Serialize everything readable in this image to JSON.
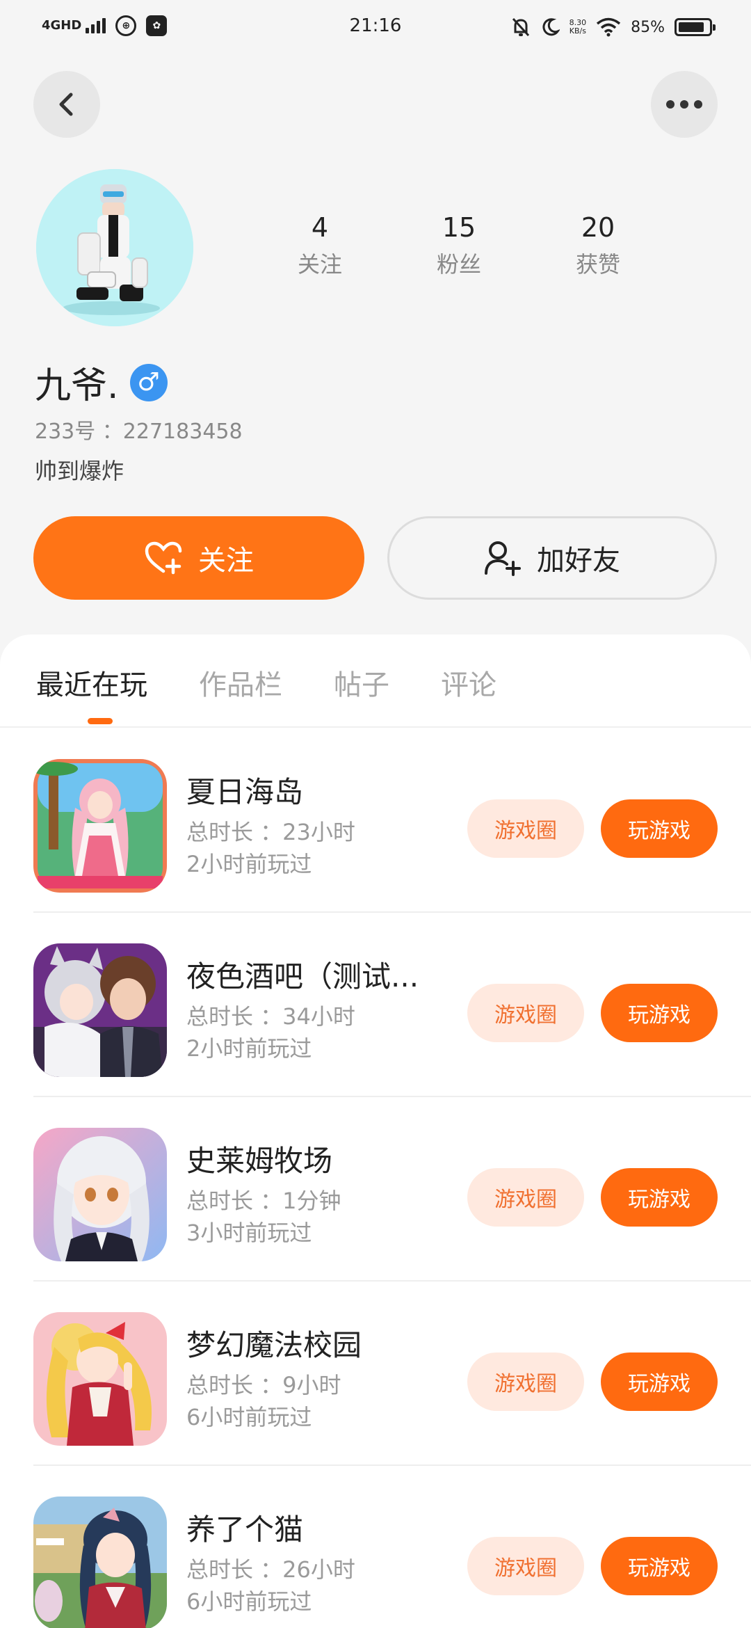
{
  "status_bar": {
    "network": "4GHD",
    "time": "21:16",
    "speed_value": "8.30",
    "speed_unit": "KB/s",
    "battery": "85%",
    "battery_level": 0.85
  },
  "profile": {
    "name": "九爷.",
    "gender_symbol": "♂",
    "uid": "233号 ：227183458",
    "bio": "帅到爆炸",
    "stats": [
      {
        "value": "4",
        "label": "关注"
      },
      {
        "value": "15",
        "label": "粉丝"
      },
      {
        "value": "20",
        "label": "获赞"
      }
    ]
  },
  "actions": {
    "follow_label": "关注",
    "add_friend_label": "加好友"
  },
  "tabs": [
    {
      "label": "最近在玩",
      "active": true
    },
    {
      "label": "作品栏",
      "active": false
    },
    {
      "label": "帖子",
      "active": false
    },
    {
      "label": "评论",
      "active": false
    }
  ],
  "games": [
    {
      "title": "夏日海岛",
      "duration": "总时长 ：23小时",
      "last_played": "2小时前玩过",
      "circle_label": "游戏圈",
      "play_label": "玩游戏"
    },
    {
      "title": "夜色酒吧（测试...",
      "duration": "总时长 ：34小时",
      "last_played": "2小时前玩过",
      "circle_label": "游戏圈",
      "play_label": "玩游戏"
    },
    {
      "title": "史莱姆牧场",
      "duration": "总时长 ：1分钟",
      "last_played": "3小时前玩过",
      "circle_label": "游戏圈",
      "play_label": "玩游戏"
    },
    {
      "title": "梦幻魔法校园",
      "duration": "总时长 ：9小时",
      "last_played": "6小时前玩过",
      "circle_label": "游戏圈",
      "play_label": "玩游戏"
    },
    {
      "title": "养了个猫",
      "duration": "总时长 ：26小时",
      "last_played": "6小时前玩过",
      "circle_label": "游戏圈",
      "play_label": "玩游戏"
    }
  ],
  "colors": {
    "accent": "#ff6a10",
    "accent_light": "#ffe9df",
    "gender": "#3b95f1",
    "avatar_bg": "#bff2f5"
  },
  "icons": {
    "back": "chevron-left-icon",
    "more": "more-dots-icon",
    "follow": "heart-plus-icon",
    "add_friend": "user-plus-icon"
  }
}
